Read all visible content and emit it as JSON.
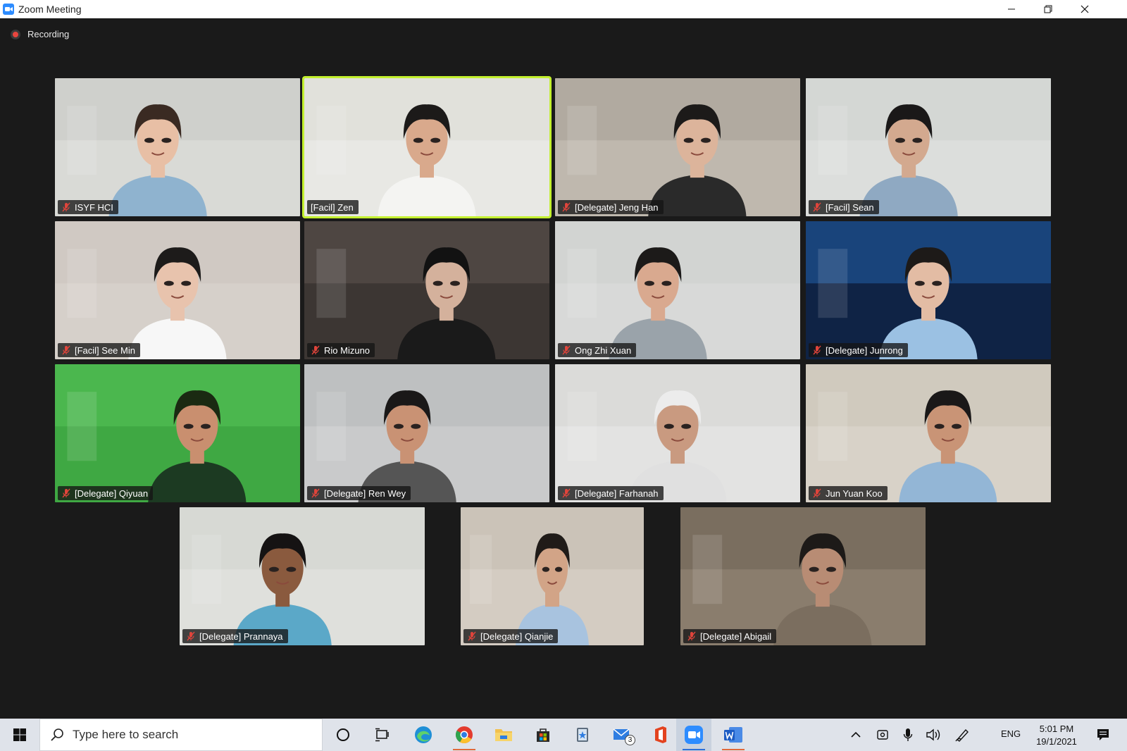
{
  "window": {
    "title": "Zoom Meeting"
  },
  "recording": {
    "label": "Recording"
  },
  "participants": [
    {
      "name": "ISYF HCI",
      "muted": true,
      "bg": "#d9dad6",
      "wall": "#c8c9c4",
      "skin": "#e8bfa5",
      "hair": "#3a2a22",
      "shirt": "#8fb3cf"
    },
    {
      "name": "[Facil] Zen",
      "muted": false,
      "active_speaker": true,
      "bg": "#e8e8e4",
      "wall": "#dcdcd6",
      "skin": "#d9a98c",
      "hair": "#1c1a19",
      "shirt": "#f4f4f2"
    },
    {
      "name": "[Delegate] Jeng Han",
      "muted": true,
      "bg": "#bfb8ae",
      "wall": "#a8a096",
      "skin": "#dcb49b",
      "hair": "#1c1a19",
      "shirt": "#2a2a2a"
    },
    {
      "name": "[Facil] Sean",
      "muted": true,
      "bg": "#dcdedc",
      "wall": "#cfd2cf",
      "skin": "#d3a98f",
      "hair": "#1a1818",
      "shirt": "#8fa9c2"
    },
    {
      "name": "[Facil] See Min",
      "muted": true,
      "bg": "#d6d0ca",
      "wall": "#ccc5be",
      "skin": "#e8c3ad",
      "hair": "#1d1b1a",
      "shirt": "#f7f7f7"
    },
    {
      "name": "Rio Mizuno",
      "muted": true,
      "bg": "#3c3633",
      "wall": "#5a524c",
      "skin": "#d4b19c",
      "hair": "#121212",
      "shirt": "#1a1a1a"
    },
    {
      "name": "Ong Zhi Xuan",
      "muted": true,
      "bg": "#d8d9d8",
      "wall": "#cfd0cf",
      "skin": "#d9a98f",
      "hair": "#1c1a19",
      "shirt": "#9aa3aa"
    },
    {
      "name": "[Delegate] Junrong",
      "muted": true,
      "bg": "#0f2345",
      "wall": "#1f5aa0",
      "skin": "#e3bca4",
      "hair": "#1d1a18",
      "shirt": "#9bc1e3"
    },
    {
      "name": "[Delegate] Qiyuan",
      "muted": true,
      "bg": "#3fa843",
      "wall": "#54c157",
      "skin": "#c98f6f",
      "hair": "#1a2a12",
      "shirt": "#1c3a22"
    },
    {
      "name": "[Delegate] Ren Wey",
      "muted": true,
      "bg": "#c9cacb",
      "wall": "#b8b9ba",
      "skin": "#c99274",
      "hair": "#1a1818",
      "shirt": "#555"
    },
    {
      "name": "[Delegate] Farhanah",
      "muted": true,
      "bg": "#e3e3e2",
      "wall": "#d6d6d4",
      "skin": "#c99a80",
      "hair": "#ececec",
      "shirt": "#e0e0e0"
    },
    {
      "name": "Jun Yuan Koo",
      "muted": true,
      "bg": "#d8d2c8",
      "wall": "#cbc4b8",
      "skin": "#c99476",
      "hair": "#1a1818",
      "shirt": "#93b6d6"
    },
    {
      "name": "[Delegate] Prannaya",
      "muted": true,
      "bg": "#dfe0dc",
      "wall": "#d2d3cf",
      "skin": "#8a5a3e",
      "hair": "#151313",
      "shirt": "#5ba8c8"
    },
    {
      "name": "[Delegate] Qianjie",
      "muted": true,
      "bg": "#d4ccc2",
      "wall": "#c5bcb0",
      "skin": "#d2a487",
      "hair": "#201b18",
      "shirt": "#a8c3df"
    },
    {
      "name": "[Delegate] Abigail",
      "muted": true,
      "bg": "#8a7d6d",
      "wall": "#6f6456",
      "skin": "#b88c74",
      "hair": "#1d1a18",
      "shirt": "#7b6e5f"
    }
  ],
  "taskbar": {
    "search_placeholder": "Type here to search",
    "language": "ENG",
    "time": "5:01 PM",
    "date": "19/1/2021",
    "mail_badge": "3"
  },
  "colors": {
    "active_speaker_border": "#c3f02e",
    "mute_icon": "#e0443b",
    "zoom_blue": "#2d8cff"
  }
}
